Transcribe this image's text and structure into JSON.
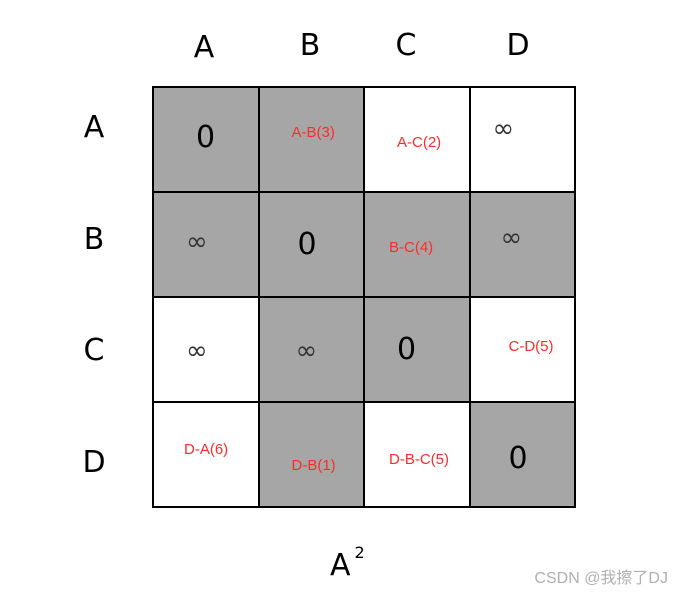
{
  "column_headers": [
    "A",
    "B",
    "C",
    "D"
  ],
  "row_headers": [
    "A",
    "B",
    "C",
    "D"
  ],
  "matrix": [
    [
      {
        "text": "0",
        "kind": "zero",
        "shaded": true
      },
      {
        "text": "A-B(3)",
        "kind": "path",
        "shaded": true
      },
      {
        "text": "A-C(2)",
        "kind": "path",
        "shaded": false
      },
      {
        "text": "∞",
        "kind": "inf",
        "shaded": false
      }
    ],
    [
      {
        "text": "∞",
        "kind": "inf",
        "shaded": true
      },
      {
        "text": "0",
        "kind": "zero",
        "shaded": true
      },
      {
        "text": "B-C(4)",
        "kind": "path",
        "shaded": true
      },
      {
        "text": "∞",
        "kind": "inf",
        "shaded": true
      }
    ],
    [
      {
        "text": "∞",
        "kind": "inf",
        "shaded": false
      },
      {
        "text": "∞",
        "kind": "inf",
        "shaded": true
      },
      {
        "text": "0",
        "kind": "zero",
        "shaded": true
      },
      {
        "text": "C-D(5)",
        "kind": "path",
        "shaded": false
      }
    ],
    [
      {
        "text": "D-A(6)",
        "kind": "path",
        "shaded": false
      },
      {
        "text": "D-B(1)",
        "kind": "path",
        "shaded": true
      },
      {
        "text": "D-B-C(5)",
        "kind": "path",
        "shaded": false
      },
      {
        "text": "0",
        "kind": "zero",
        "shaded": true
      }
    ]
  ],
  "caption": {
    "base": "A",
    "exponent": "2"
  },
  "watermark": "CSDN @我擦了DJ",
  "colors": {
    "shaded_cell": "#a6a6a6",
    "path_text": "#ff2a2a",
    "grid_line": "#000000"
  }
}
